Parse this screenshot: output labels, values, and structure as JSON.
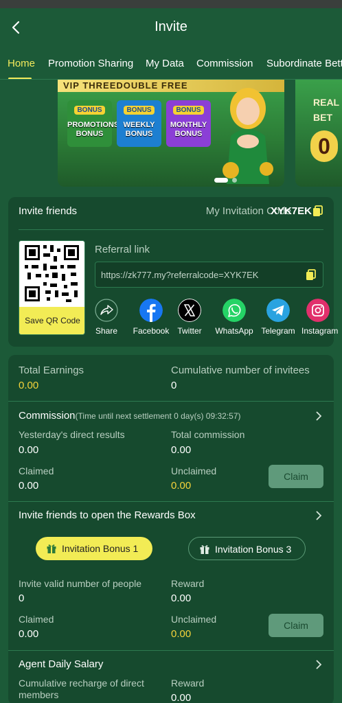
{
  "header": {
    "title": "Invite"
  },
  "tabs": [
    "Home",
    "Promotion Sharing",
    "My Data",
    "Commission",
    "Subordinate Betting"
  ],
  "banner": {
    "headline": "VIP THREEDOUBLE FREE",
    "cards": [
      {
        "tag": "BONUS",
        "sub": "Promotions",
        "title": "PROMOTIONS BONUS",
        "color": "#2f8f3a"
      },
      {
        "tag": "BONUS",
        "sub": "Weekly",
        "title": "WEEKLY BONUS",
        "color": "#1d7fd1"
      },
      {
        "tag": "BONUS",
        "sub": "Monthly",
        "title": "MONTHLY BONUS",
        "color": "#8b3fd6"
      }
    ],
    "next_text": "REAL BET",
    "next_value": "0"
  },
  "invite": {
    "title": "Invite friends",
    "code_label": "My Invitation Code",
    "code": "XYK7EK",
    "save_qr": "Save QR Code",
    "referral_label": "Referral link",
    "referral_link": "https://zk777.my?referralcode=XYK7EK",
    "share": [
      {
        "label": "Share",
        "icon": "share-icon",
        "color": "#164a2e"
      },
      {
        "label": "Facebook",
        "icon": "facebook-icon",
        "color": "#1877f2"
      },
      {
        "label": "Twitter",
        "icon": "x-icon",
        "color": "#000000"
      },
      {
        "label": "WhatsApp",
        "icon": "whatsapp-icon",
        "color": "#25d366"
      },
      {
        "label": "Telegram",
        "icon": "telegram-icon",
        "color": "#2aa3e0"
      },
      {
        "label": "Instagram",
        "icon": "instagram-icon",
        "color": "#e1306c"
      }
    ]
  },
  "stats": {
    "total_earnings_label": "Total Earnings",
    "total_earnings": "0.00",
    "invitees_label": "Cumulative number of invitees",
    "invitees": "0"
  },
  "commission": {
    "title": "Commission",
    "subtitle": "(Time until next settlement 0 day(s) 09:32:57)",
    "yesterday_label": "Yesterday's direct results",
    "yesterday": "0.00",
    "total_label": "Total commission",
    "total": "0.00",
    "claimed_label": "Claimed",
    "claimed": "0.00",
    "unclaimed_label": "Unclaimed",
    "unclaimed": "0.00",
    "claim_button": "Claim"
  },
  "rewards": {
    "title": "Invite friends to open the Rewards Box",
    "tab_active": "Invitation Bonus 1",
    "tab_inactive": "Invitation Bonus 3",
    "valid_label": "Invite valid number of people",
    "valid": "0",
    "reward_label": "Reward",
    "reward": "0.00",
    "claimed_label": "Claimed",
    "claimed": "0.00",
    "unclaimed_label": "Unclaimed",
    "unclaimed": "0.00",
    "claim_button": "Claim"
  },
  "salary": {
    "title": "Agent Daily Salary",
    "recharge_label": "Cumulative recharge of direct members",
    "reward_label": "Reward",
    "reward": "0.00"
  },
  "colors": {
    "accent": "#f2ec55",
    "background": "#1c5a38",
    "card": "#164a2e",
    "yellow_value": "#f4d33b"
  }
}
